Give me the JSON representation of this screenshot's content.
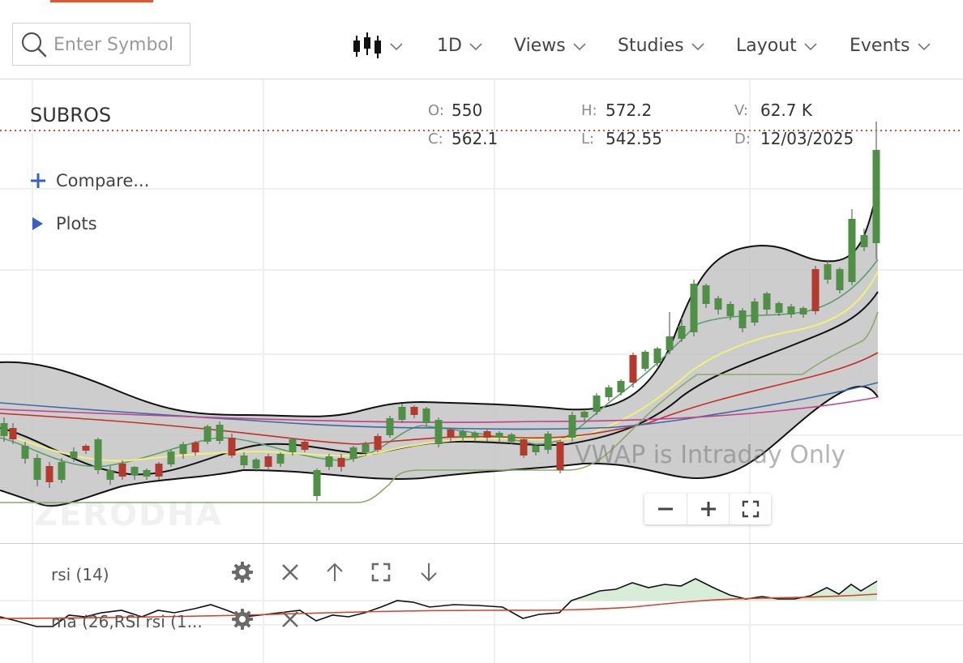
{
  "toolbar": {
    "search_placeholder": "Enter Symbol",
    "icons": {
      "search": "search-icon",
      "chart_type": "candlestick-icon",
      "chevron": "chevron-down-icon"
    },
    "menus": [
      {
        "label": "1D"
      },
      {
        "label": "Views"
      },
      {
        "label": "Studies"
      },
      {
        "label": "Layout"
      },
      {
        "label": "Events"
      }
    ],
    "accent_color": "#e0582c"
  },
  "symbol": {
    "name": "SUBROS",
    "ohlc": {
      "open_label": "O:",
      "open": "550",
      "high_label": "H:",
      "high": "572.2",
      "volume_label": "V:",
      "volume": "62.7 K",
      "close_label": "C:",
      "close": "562.1",
      "low_label": "L:",
      "low": "542.55",
      "date_label": "D:",
      "date": "12/03/2025"
    }
  },
  "side_panel": {
    "compare_label": "Compare...",
    "plots_label": "Plots"
  },
  "watermark": "ZERODHA",
  "vwap_note": "VWAP is Intraday Only",
  "zoom_controls": {
    "icons": [
      "minus-icon",
      "plus-icon",
      "fullscreen-icon"
    ]
  },
  "studies": [
    {
      "label": "rsi (14)",
      "icons": [
        "gear-icon",
        "close-icon",
        "arrow-up-icon",
        "fullscreen-icon",
        "arrow-down-icon"
      ]
    },
    {
      "label": "ma (26,RSI rsi (1...",
      "icons": [
        "gear-icon",
        "close-icon"
      ]
    }
  ],
  "colors": {
    "up_candle": "#4f8f46",
    "down_candle": "#b23a2f",
    "band_fill": "#c4c4c4",
    "ema_short": "#5f9e6e",
    "ema_yellow": "#f0f07a",
    "ma_red": "#c62f25",
    "ma_blue": "#3b6aa8",
    "ma_magenta": "#c0418e",
    "supertrend": "#8ea86a",
    "price_line": "#c8573a",
    "rsi_line": "#111111",
    "rsi_ma": "#d0432e",
    "rsi_fill": "#cde8cd"
  }
}
